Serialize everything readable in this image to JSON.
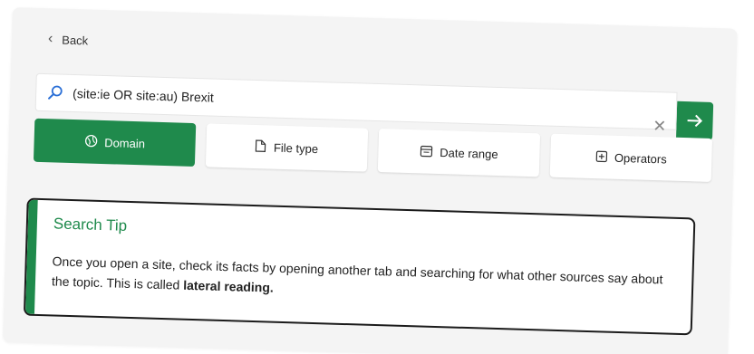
{
  "nav": {
    "back_label": "Back"
  },
  "search": {
    "query": "(site:ie OR site:au) Brexit",
    "placeholder": ""
  },
  "filters": {
    "domain_label": "Domain",
    "file_type_label": "File type",
    "date_range_label": "Date range",
    "operators_label": "Operators",
    "active": "Domain"
  },
  "tip": {
    "title": "Search Tip",
    "body_prefix": "Once you open a site, check its facts by opening another tab and searching for what other sources say about the topic. This is called ",
    "body_bold": "lateral reading.",
    "body_suffix": ""
  },
  "below": {
    "text": ""
  },
  "colors": {
    "accent": "#1f8a4c",
    "panel_bg": "#f4f4f4",
    "border_dark": "#1b1b1b"
  },
  "icons": {
    "back": "chevron-left-icon",
    "search": "search-icon",
    "clear": "close-icon",
    "go": "arrow-right-icon",
    "domain": "globe-icon",
    "file_type": "file-icon",
    "date_range": "calendar-icon",
    "operators": "plus-square-icon"
  }
}
